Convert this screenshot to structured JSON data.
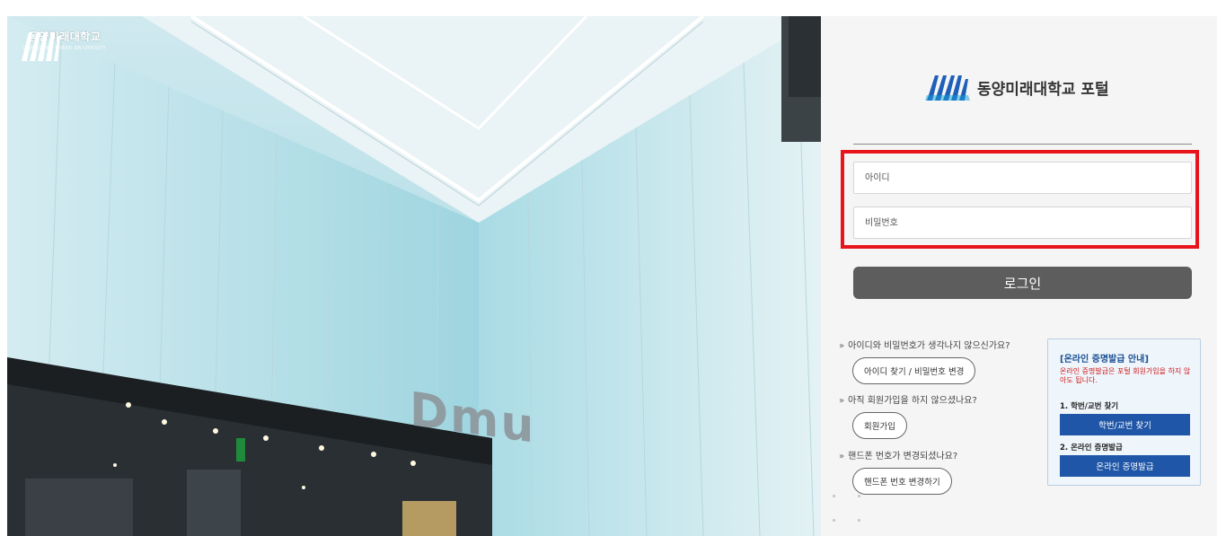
{
  "brand": {
    "name_ko": "동양미래대학교",
    "name_en": "DONGYANG MIRAE UNIVERSITY",
    "logo_icon": "dmu-wave-logo-icon"
  },
  "photo": {
    "sign_text": "Dmu"
  },
  "portal": {
    "title": "동양미래대학교 포털"
  },
  "login": {
    "id_placeholder": "아이디",
    "id_value": "",
    "pw_placeholder": "비밀번호",
    "pw_value": "",
    "button_label": "로그인"
  },
  "help": {
    "arrow": "»",
    "forgot_question": "아이디와 비밀번호가 생각나지 않으신가요?",
    "forgot_button": "아이디 찾기 / 비밀번호 변경",
    "signup_question": "아직 회원가입을 하지 않으셨나요?",
    "signup_button": "회원가입",
    "phone_question": "핸드폰 번호가 변경되셨나요?",
    "phone_button": "핸드폰 번호 변경하기"
  },
  "notice": {
    "title": "[온라인 증명발급 안내]",
    "description": "온라인 증명발급은 포털 회원가입을 하지 않아도 됩니다.",
    "step1_label": "1. 학번/교번 찾기",
    "step1_button": "학번/교번 찾기",
    "step2_label": "2. 온라인 증명발급",
    "step2_button": "온라인 증명발급"
  },
  "colors": {
    "highlight_border": "#e8141b",
    "login_button": "#5d5d5d",
    "notice_button": "#1f56a7",
    "notice_title": "#1b4f92",
    "notice_desc": "#d11b1b",
    "logo_blue": "#1f5fb8"
  }
}
